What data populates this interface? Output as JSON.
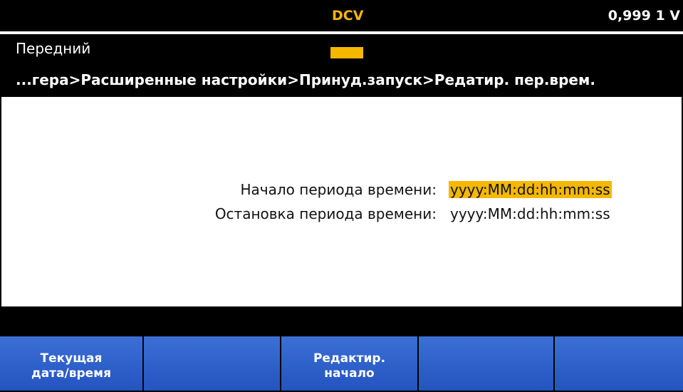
{
  "status_bar": {
    "mode": "DCV",
    "reading": "0,999 1 V"
  },
  "info": {
    "terminal": "Передний",
    "indicator_color": "#f5b800",
    "breadcrumb": "...гера>Расширенные настройки>Принуд.запуск>Редатир. пер.врем."
  },
  "fields": [
    {
      "label": "Начало периода времени:",
      "value": "yyyy:MM:dd:hh:mm:ss",
      "highlighted": true
    },
    {
      "label": "Остановка периода времени:",
      "value": "yyyy:MM:dd:hh:mm:ss",
      "highlighted": false
    }
  ],
  "softkeys": [
    {
      "label": "Текущая\nдата/время"
    },
    {
      "label": ""
    },
    {
      "label": "Редактир.\nначало"
    },
    {
      "label": ""
    },
    {
      "label": ""
    }
  ],
  "colors": {
    "accent": "#f5b800",
    "softkey": "#2b5fcc",
    "background": "#000000"
  }
}
